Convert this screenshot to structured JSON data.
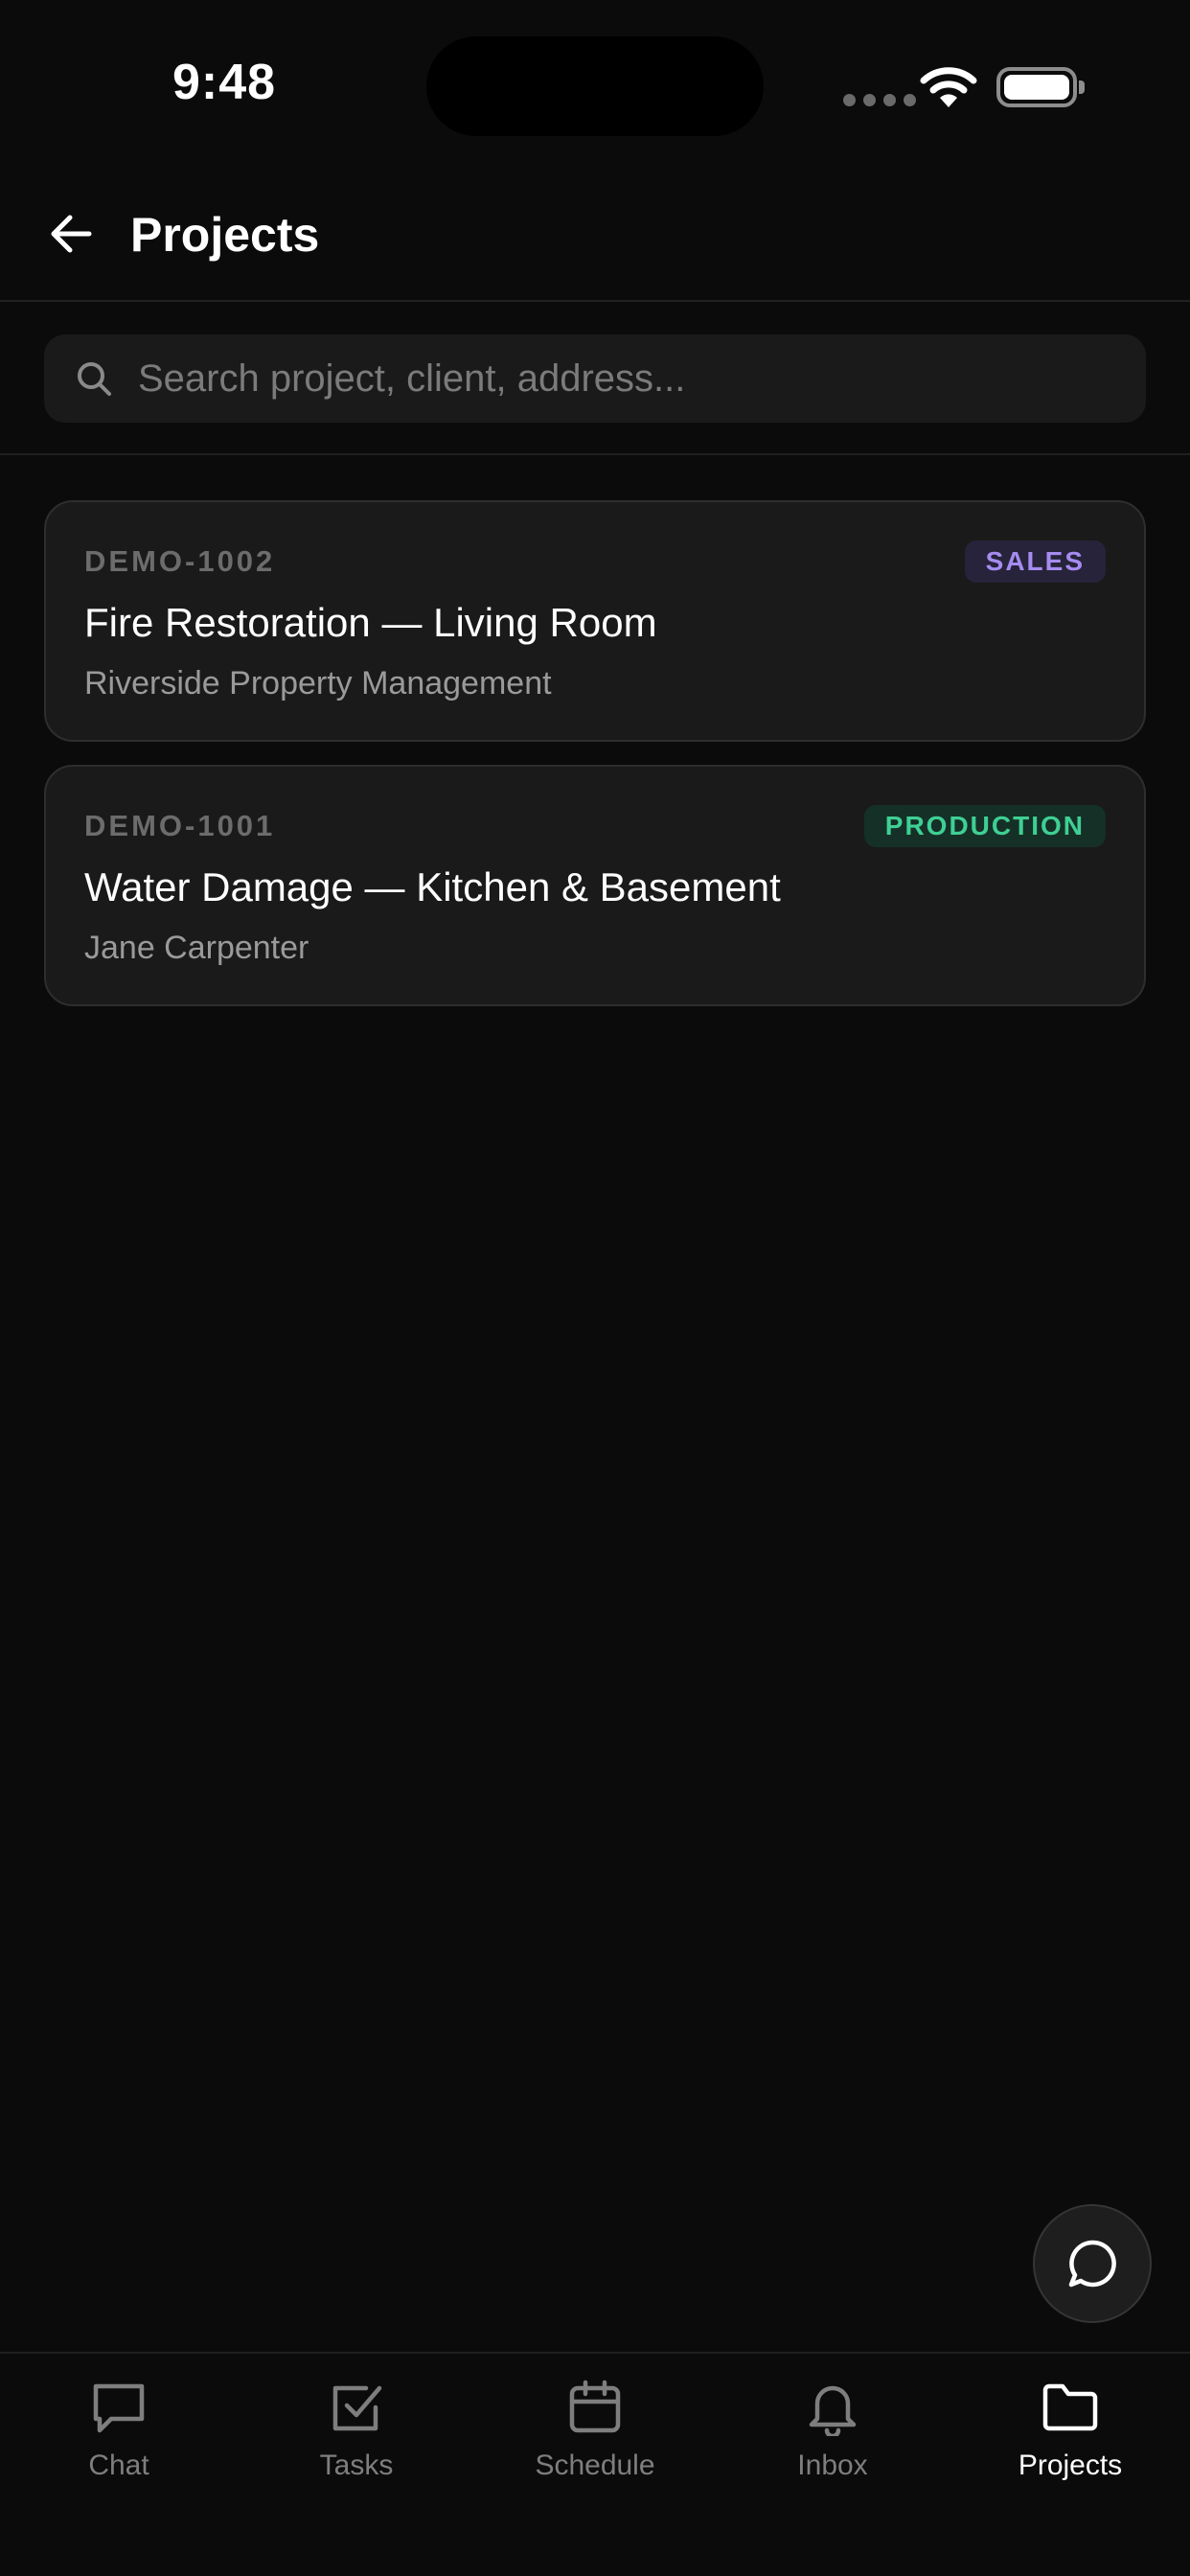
{
  "status_bar": {
    "time": "9:48"
  },
  "header": {
    "title": "Projects"
  },
  "search": {
    "placeholder": "Search project, client, address..."
  },
  "projects": [
    {
      "id": "DEMO-1002",
      "title": "Fire Restoration — Living Room",
      "client": "Riverside Property Management",
      "stage": "SALES",
      "stage_color": "#a58cf0"
    },
    {
      "id": "DEMO-1001",
      "title": "Water Damage — Kitchen & Basement",
      "client": "Jane Carpenter",
      "stage": "PRODUCTION",
      "stage_color": "#3fcf94"
    }
  ],
  "tabs": [
    {
      "label": "Chat",
      "icon": "chat-bubble-icon",
      "active": false
    },
    {
      "label": "Tasks",
      "icon": "checkbox-icon",
      "active": false
    },
    {
      "label": "Schedule",
      "icon": "calendar-icon",
      "active": false
    },
    {
      "label": "Inbox",
      "icon": "bell-icon",
      "active": false
    },
    {
      "label": "Projects",
      "icon": "folder-icon",
      "active": true
    }
  ],
  "colors": {
    "background": "#0b0b0b",
    "card": "#1a1a1a",
    "active_tab": "#ffffff",
    "inactive_tab": "#7e7e7e"
  }
}
